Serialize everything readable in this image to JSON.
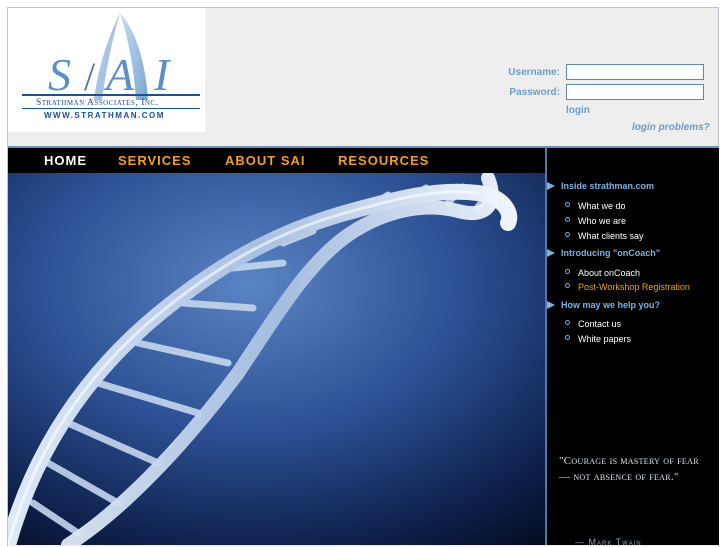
{
  "logo": {
    "letters": "SAI",
    "company": "Strathman Associates, Inc.",
    "url": "www.strathman.com"
  },
  "login": {
    "username_label": "Username:",
    "password_label": "Password:",
    "username_value": "",
    "password_value": "",
    "login_link": "login",
    "problems_link": "login problems?"
  },
  "nav": {
    "items": [
      "HOME",
      "SERVICES",
      "ABOUT SAI",
      "RESOURCES"
    ]
  },
  "sidebar": {
    "sections": [
      {
        "title": "Inside strathman.com",
        "items": [
          "What we do",
          "Who we are",
          "What clients say"
        ]
      },
      {
        "title": "Introducing \"onCoach\"",
        "items": [
          "About onCoach",
          "Post-Workshop Registration"
        ]
      },
      {
        "title": "How may we help you?",
        "items": [
          "Contact us",
          "White papers"
        ]
      }
    ],
    "quote": "\"Courage is mastery of fear — not absence of fear.\"",
    "author": "— Mark Twain"
  },
  "colors": {
    "accent_blue": "#7fb0e0",
    "nav_orange": "#f0a020",
    "logo_blue": "#1a4f9a"
  }
}
